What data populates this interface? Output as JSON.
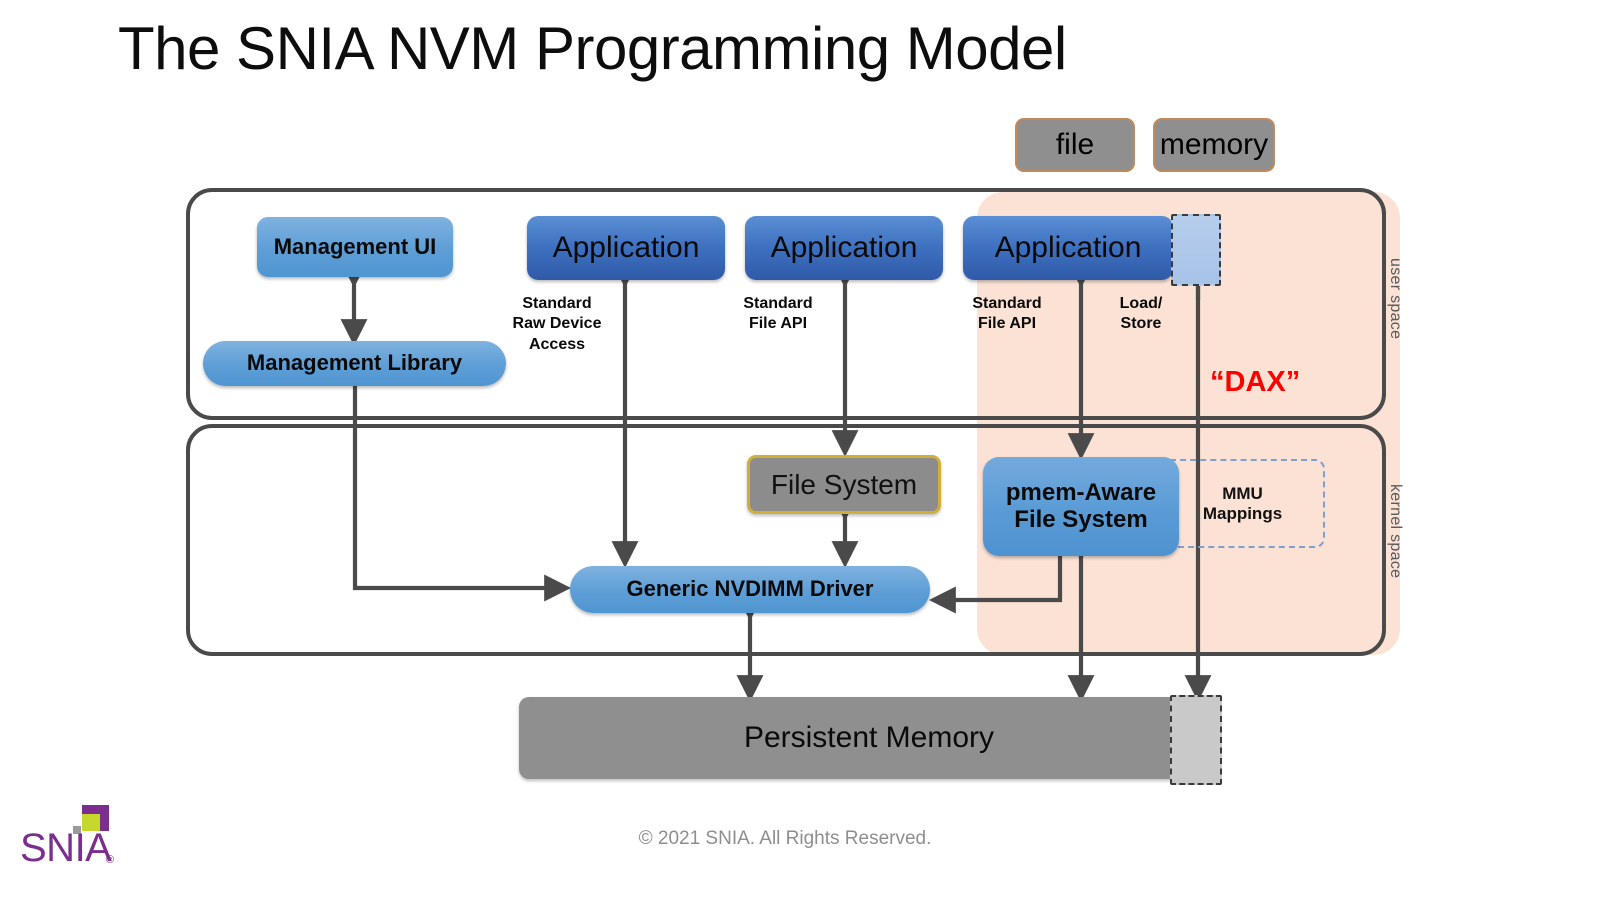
{
  "slide": {
    "title": "The SNIA NVM Programming Model",
    "copyright": "© 2021 SNIA. All Rights Reserved.",
    "logo_text": "SNIA",
    "logo_registered": "®"
  },
  "colors": {
    "dax_region": "#fbe2d4",
    "dax_label": "#ff0000",
    "application_blue": "#3f71c1",
    "light_blue": "#5e9ed6",
    "gray_chip": "#8f8f8f",
    "gold_border": "#cfae3c",
    "space_border": "#4a4a4a",
    "connector": "#4a4a4a",
    "logo_purple": "#7b2e8e",
    "logo_green": "#c4d82e"
  },
  "chips": [
    {
      "label": "file",
      "name": "chip-file"
    },
    {
      "label": "memory",
      "name": "chip-memory"
    }
  ],
  "regions": {
    "user_space_label": "user space",
    "kernel_space_label": "kernel space",
    "dax_label": "“DAX”"
  },
  "user_space": {
    "management_ui": "Management UI",
    "management_library": "Management Library",
    "applications": [
      {
        "label": "Application",
        "name": "application-raw-device"
      },
      {
        "label": "Application",
        "name": "application-file-api"
      },
      {
        "label": "Application",
        "name": "application-dax"
      }
    ],
    "captions": [
      {
        "name": "caption-standard-raw-device-access",
        "text": "Standard\nRaw Device\nAccess"
      },
      {
        "name": "caption-standard-file-api-1",
        "text": "Standard\nFile API"
      },
      {
        "name": "caption-standard-file-api-2",
        "text": "Standard\nFile API"
      },
      {
        "name": "caption-load-store",
        "text": "Load/\nStore"
      }
    ]
  },
  "kernel_space": {
    "file_system": "File System",
    "pmem_aware_file_system": "pmem-Aware\nFile System",
    "mmu_mappings": "MMU\nMappings",
    "generic_nvdimm_driver": "Generic NVDIMM Driver"
  },
  "hardware": {
    "persistent_memory": "Persistent Memory"
  },
  "chart_data": {
    "type": "diagram",
    "title": "The SNIA NVM Programming Model",
    "layers": [
      {
        "name": "user space",
        "nodes": [
          "Management UI",
          "Management Library",
          "Application",
          "Application",
          "Application"
        ]
      },
      {
        "name": "kernel space",
        "nodes": [
          "File System",
          "pmem-Aware File System",
          "MMU Mappings",
          "Generic NVDIMM Driver"
        ]
      },
      {
        "name": "hardware",
        "nodes": [
          "Persistent Memory"
        ]
      }
    ],
    "edges": [
      {
        "from": "Management UI",
        "to": "Management Library",
        "label": "",
        "bidirectional": true
      },
      {
        "from": "Management Library",
        "to": "Generic NVDIMM Driver",
        "label": "",
        "bidirectional": false
      },
      {
        "from": "Application",
        "to": "Generic NVDIMM Driver",
        "label": "Standard Raw Device Access",
        "bidirectional": true
      },
      {
        "from": "Application",
        "to": "File System",
        "label": "Standard File API",
        "bidirectional": true
      },
      {
        "from": "File System",
        "to": "Generic NVDIMM Driver",
        "label": "",
        "bidirectional": true
      },
      {
        "from": "Application",
        "to": "pmem-Aware File System",
        "label": "Standard File API",
        "bidirectional": true
      },
      {
        "from": "Application",
        "to": "Persistent Memory",
        "label": "Load/Store",
        "bidirectional": false
      },
      {
        "from": "pmem-Aware File System",
        "to": "Generic NVDIMM Driver",
        "label": "",
        "bidirectional": false
      },
      {
        "from": "pmem-Aware File System",
        "to": "Persistent Memory",
        "label": "",
        "bidirectional": true
      },
      {
        "from": "Generic NVDIMM Driver",
        "to": "Persistent Memory",
        "label": "",
        "bidirectional": true
      }
    ],
    "annotations": [
      "“DAX”",
      "file",
      "memory"
    ]
  }
}
